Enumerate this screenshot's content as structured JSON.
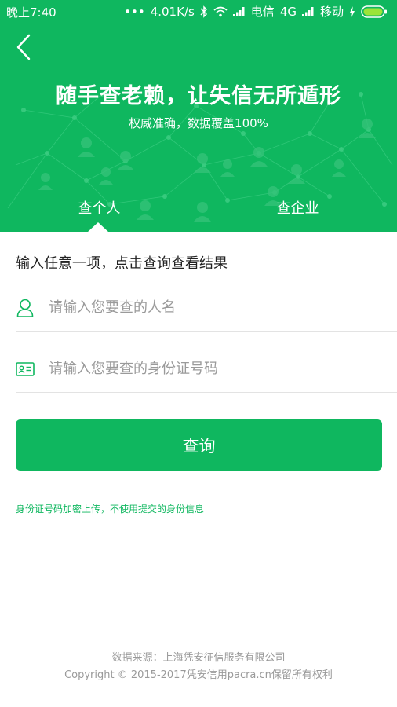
{
  "status_bar": {
    "time": "晚上7:40",
    "dots": "•••",
    "network_speed": "4.01K/s",
    "carrier_1": "电信",
    "network_type": "4G",
    "carrier_2": "移动",
    "icons": [
      "bluetooth-icon",
      "wifi-icon",
      "signal-icon",
      "signal-icon",
      "charging-icon",
      "battery-icon"
    ]
  },
  "header": {
    "back_icon": "chevron-left-icon",
    "title": "随手查老赖，让失信无所遁形",
    "subtitle": "权威准确，数据覆盖100%"
  },
  "tabs": [
    {
      "label": "查个人",
      "active": true
    },
    {
      "label": "查企业",
      "active": false
    }
  ],
  "form": {
    "instruction": "输入任意一项，点击查询查看结果",
    "name_field": {
      "icon": "person-icon",
      "placeholder": "请输入您要查的人名",
      "value": ""
    },
    "id_field": {
      "icon": "id-card-icon",
      "placeholder": "请输入您要查的身份证号码",
      "value": ""
    },
    "submit_label": "查询",
    "privacy_note": "身份证号码加密上传，不使用提交的身份信息"
  },
  "footer": {
    "source": "数据来源：上海凭安征信服务有限公司",
    "copyright": "Copyright © 2015-2017凭安信用pacra.cn保留所有权利"
  },
  "colors": {
    "brand_green": "#0fb75f",
    "text_dark": "#222222",
    "text_gray": "#9a9a9a",
    "divider": "#e3e3e3"
  }
}
